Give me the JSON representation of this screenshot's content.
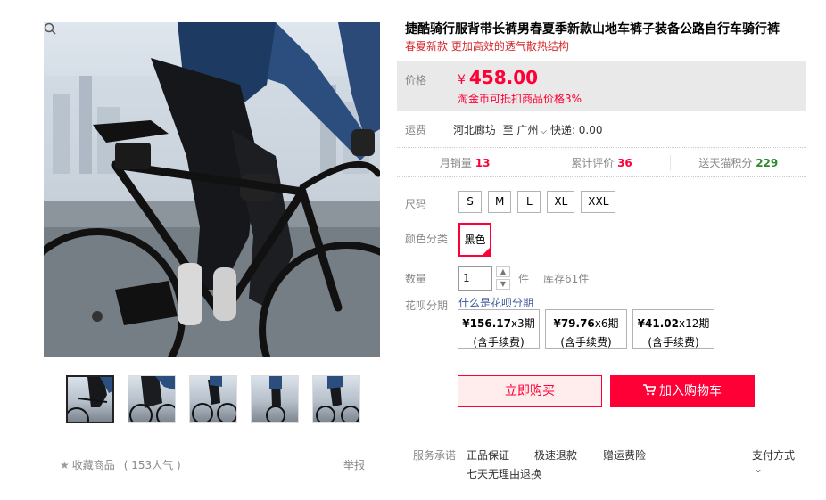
{
  "product": {
    "title": "捷酷骑行服背带长裤男春夏季新款山地车裤子装备公路自行车骑行裤",
    "subtitle": "春夏新款 更加高效的透气散热结构"
  },
  "price": {
    "label": "价格",
    "currency": "¥",
    "value": "458.00",
    "note": "淘金币可抵扣商品价格3%"
  },
  "shipping": {
    "label": "运费",
    "from": "河北廊坊",
    "to_word": "至",
    "to": "广州",
    "express": "快递: 0.00"
  },
  "stats": [
    {
      "label": "月销量",
      "value": "13",
      "color": "red"
    },
    {
      "label": "累计评价",
      "value": "36",
      "color": "red"
    },
    {
      "label": "送天猫积分",
      "value": "229",
      "color": "green"
    }
  ],
  "sizes": {
    "label": "尺码",
    "options": [
      "S",
      "M",
      "L",
      "XL",
      "XXL"
    ]
  },
  "color": {
    "label": "颜色分类",
    "selected": "黑色"
  },
  "quantity": {
    "label": "数量",
    "value": "1",
    "unit": "件",
    "stock": "库存61件"
  },
  "huabei": {
    "label": "花呗分期",
    "link": "什么是花呗分期",
    "plans": [
      {
        "amount": "¥156.17",
        "periods": "x3期",
        "note": "(含手续费)"
      },
      {
        "amount": "¥79.76",
        "periods": "x6期",
        "note": "(含手续费)"
      },
      {
        "amount": "¥41.02",
        "periods": "x12期",
        "note": "(含手续费)"
      }
    ]
  },
  "actions": {
    "buy_now": "立即购买",
    "add_cart": "加入购物车"
  },
  "service": {
    "label": "服务承诺",
    "items": [
      "正品保证",
      "极速退款",
      "赠运费险",
      "七天无理由退换"
    ],
    "payment": "支付方式"
  },
  "favorite": {
    "label": "收藏商品",
    "popularity": "( 153人气 )"
  },
  "report": "举报",
  "colors": {
    "accent": "#ff0036",
    "price_bg": "#e9e9e9",
    "link": "#3c5a9a"
  }
}
